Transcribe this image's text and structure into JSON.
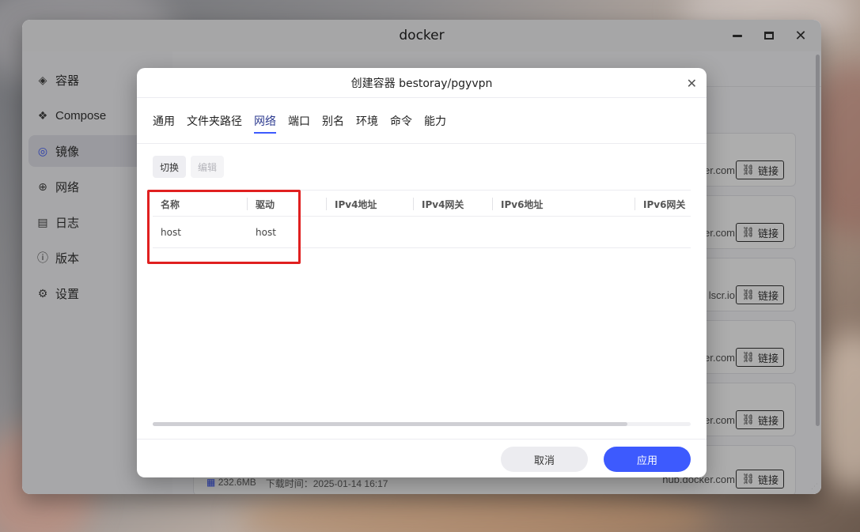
{
  "app": {
    "title": "docker"
  },
  "window_controls": {
    "minimize": "minimize-icon",
    "maximize": "maximize-icon",
    "close": "close-icon"
  },
  "sidebar": {
    "items": [
      {
        "label": "容器",
        "icon": "layers-icon",
        "active": false
      },
      {
        "label": "Compose",
        "icon": "cubes-icon",
        "active": false
      },
      {
        "label": "镜像",
        "icon": "disc-icon",
        "active": true
      },
      {
        "label": "网络",
        "icon": "globe-icon",
        "active": false
      },
      {
        "label": "日志",
        "icon": "document-icon",
        "active": false
      },
      {
        "label": "版本",
        "icon": "info-icon",
        "active": false
      },
      {
        "label": "设置",
        "icon": "gear-icon",
        "active": false
      }
    ]
  },
  "images": {
    "cards": [
      {
        "registry": "er.com",
        "link_label": "链接"
      },
      {
        "registry": "er.com",
        "link_label": "链接"
      },
      {
        "registry": "lscr.io",
        "link_label": "链接"
      },
      {
        "registry": "er.com",
        "link_label": "链接"
      },
      {
        "registry": "er.com",
        "link_label": "链接"
      },
      {
        "registry": "hub.docker.com",
        "link_label": "链接",
        "size": "232.6MB",
        "download_time": "下载时间：2025-01-14 16:17"
      }
    ]
  },
  "dialog": {
    "title": "创建容器 bestoray/pgyvpn",
    "tabs": [
      "通用",
      "文件夹路径",
      "网络",
      "端口",
      "别名",
      "环境",
      "命令",
      "能力"
    ],
    "active_tab": "网络",
    "toolbar": {
      "switch_label": "切换",
      "edit_label": "编辑"
    },
    "table": {
      "columns": [
        "名称",
        "驱动",
        "IPv4地址",
        "IPv4网关",
        "IPv6地址",
        "IPv6网关"
      ],
      "rows": [
        {
          "name": "host",
          "driver": "host",
          "ipv4": "",
          "ipv4_gateway": "",
          "ipv6": "",
          "ipv6_gateway": ""
        }
      ]
    },
    "footer": {
      "cancel_label": "取消",
      "apply_label": "应用"
    }
  },
  "colors": {
    "accent": "#3d5afe",
    "highlight": "#e02020"
  }
}
